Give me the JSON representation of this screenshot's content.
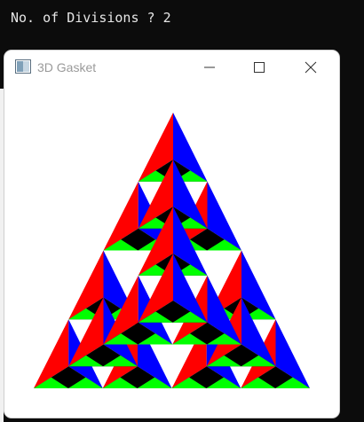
{
  "console": {
    "prompt_line": "No. of Divisions ? 2"
  },
  "window": {
    "title": "3D Gasket",
    "controls": [
      "minimize",
      "maximize",
      "close"
    ],
    "app_icon": "opengl-window-icon"
  },
  "gasket": {
    "divisions": 2,
    "face_colors": {
      "left": "#ff0000",
      "right": "#0000ff",
      "front": "#00ff00",
      "bottom": "#000000"
    }
  }
}
